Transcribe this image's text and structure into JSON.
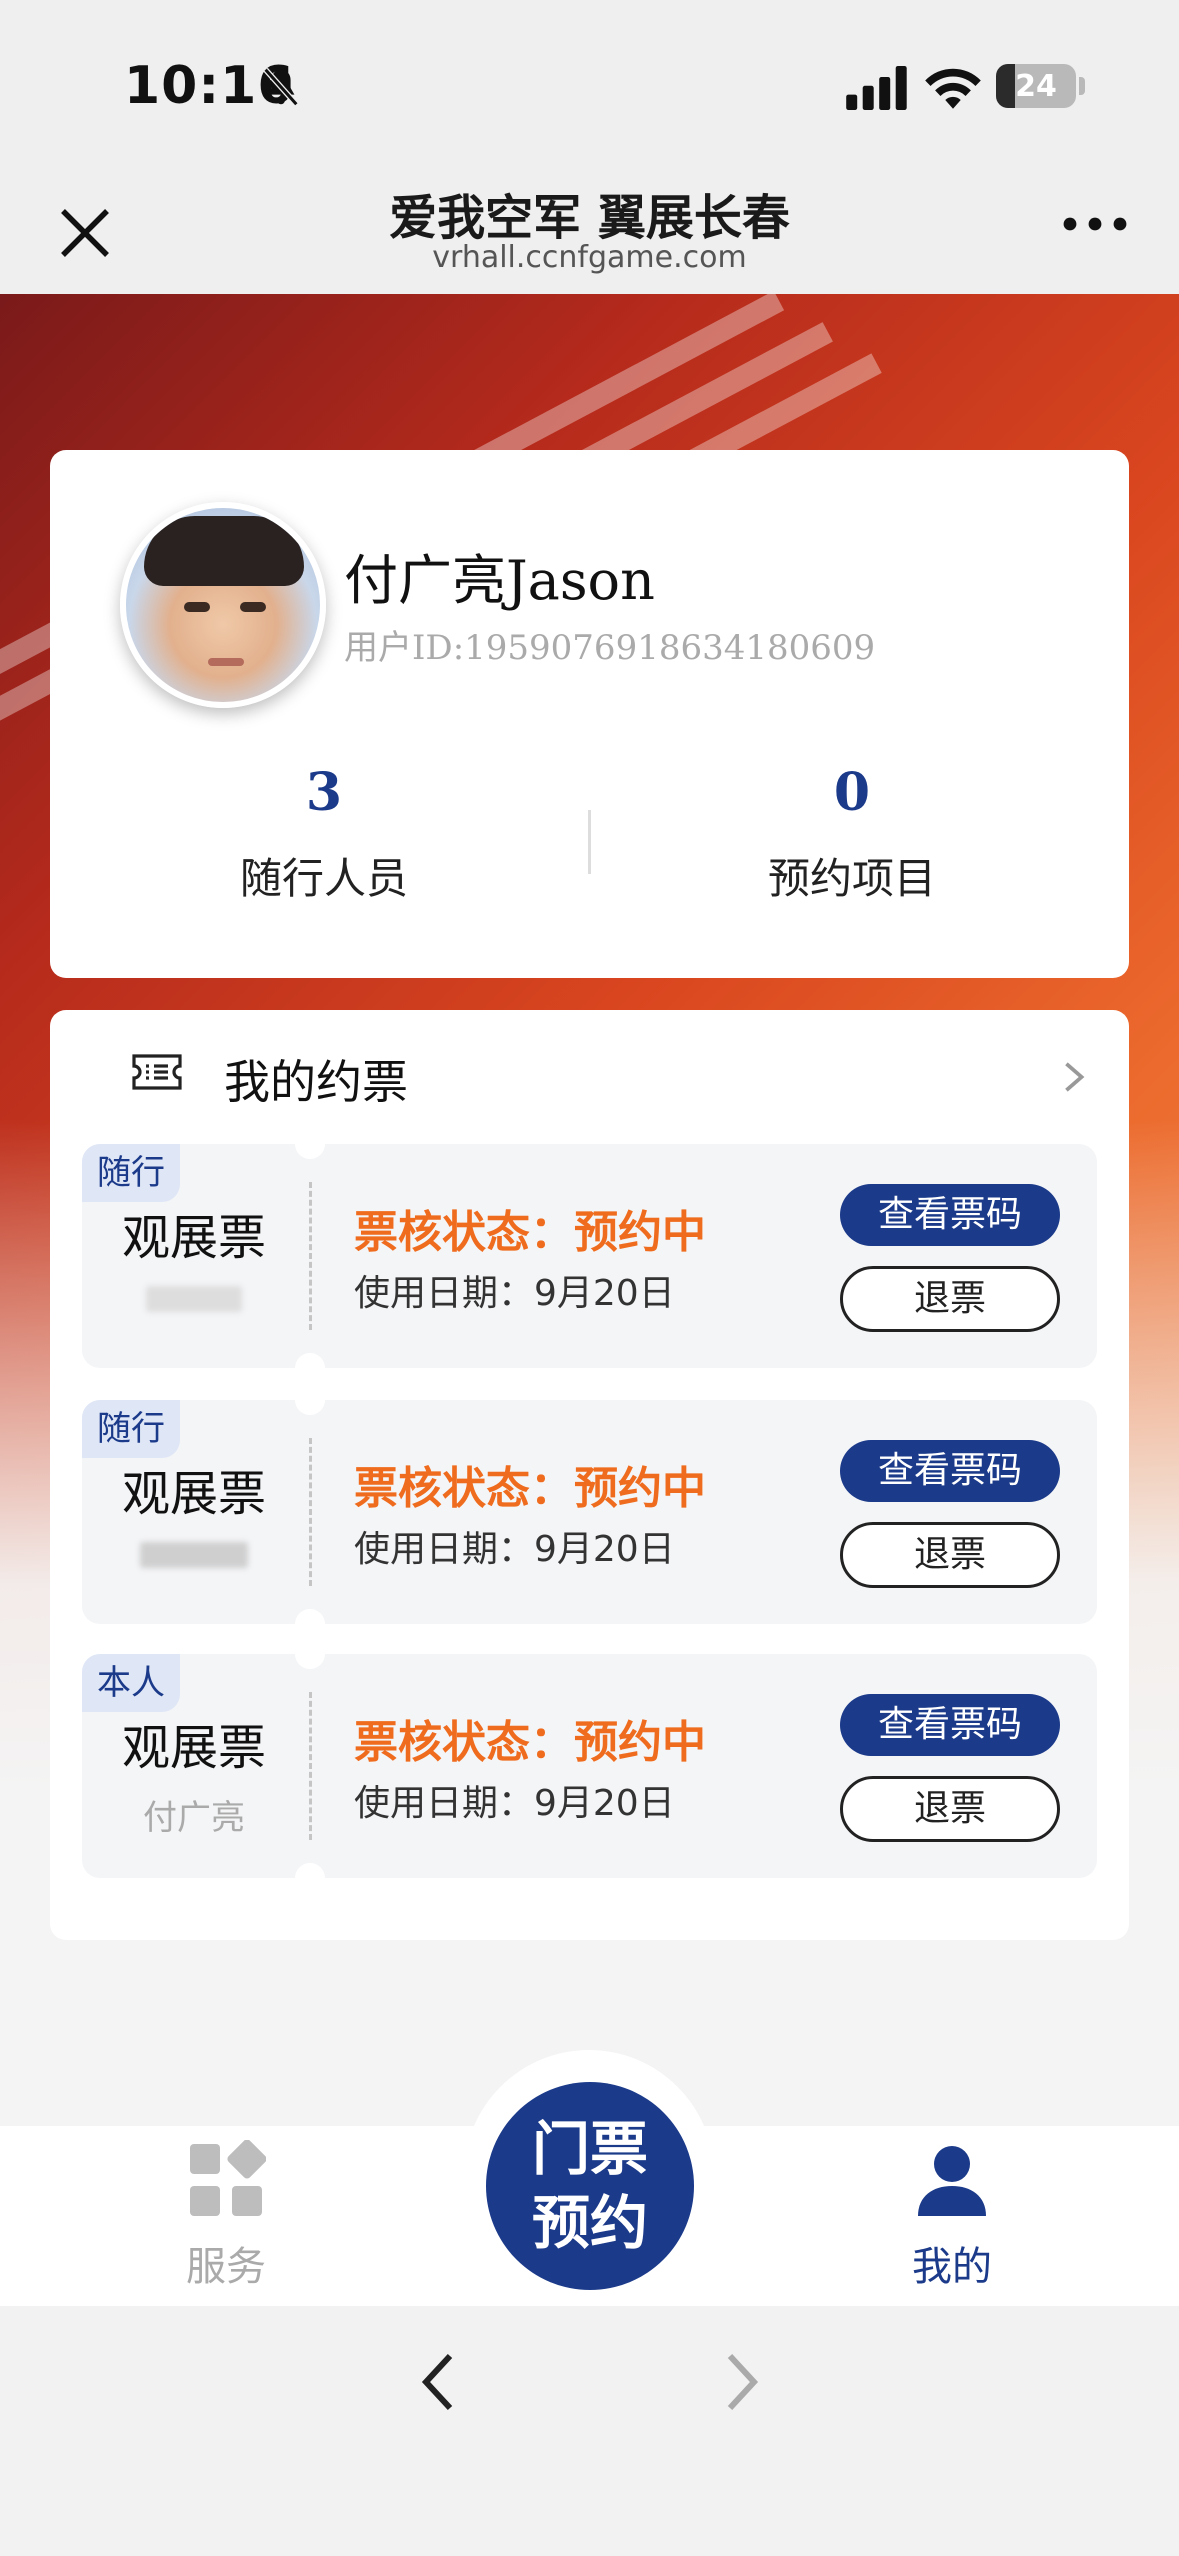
{
  "status_bar": {
    "time": "10:16",
    "battery": "24",
    "battery_level": 0.24
  },
  "header": {
    "title": "爱我空军 翼展长春",
    "url": "vrhall.ccnfgame.com"
  },
  "profile": {
    "name": "付广亮Jason",
    "user_id": "用户ID:1959076918634180609",
    "stats": [
      {
        "value": "3",
        "label": "随行人员"
      },
      {
        "value": "0",
        "label": "预约项目"
      }
    ]
  },
  "tickets_section": {
    "title": "我的约票",
    "items": [
      {
        "tag": "随行",
        "type": "观展票",
        "holder": "",
        "status": "票核状态：预约中",
        "date": "使用日期：9月20日",
        "view_label": "查看票码",
        "refund_label": "退票"
      },
      {
        "tag": "随行",
        "type": "观展票",
        "holder": "",
        "status": "票核状态：预约中",
        "date": "使用日期：9月20日",
        "view_label": "查看票码",
        "refund_label": "退票"
      },
      {
        "tag": "本人",
        "type": "观展票",
        "holder": "付广亮",
        "status": "票核状态：预约中",
        "date": "使用日期：9月20日",
        "view_label": "查看票码",
        "refund_label": "退票"
      }
    ]
  },
  "tabbar": {
    "services": "服务",
    "center_line1": "门票",
    "center_line2": "预约",
    "mine": "我的"
  },
  "colors": {
    "accent": "#1b3a8a",
    "status": "#ef6c1e"
  },
  "icons": [
    "bell-slash-icon",
    "signal-icon",
    "wifi-icon",
    "battery-icon",
    "close-icon",
    "more-icon",
    "ticket-icon",
    "chevron-right-icon",
    "grid-icon",
    "person-icon",
    "back-icon",
    "forward-icon"
  ]
}
